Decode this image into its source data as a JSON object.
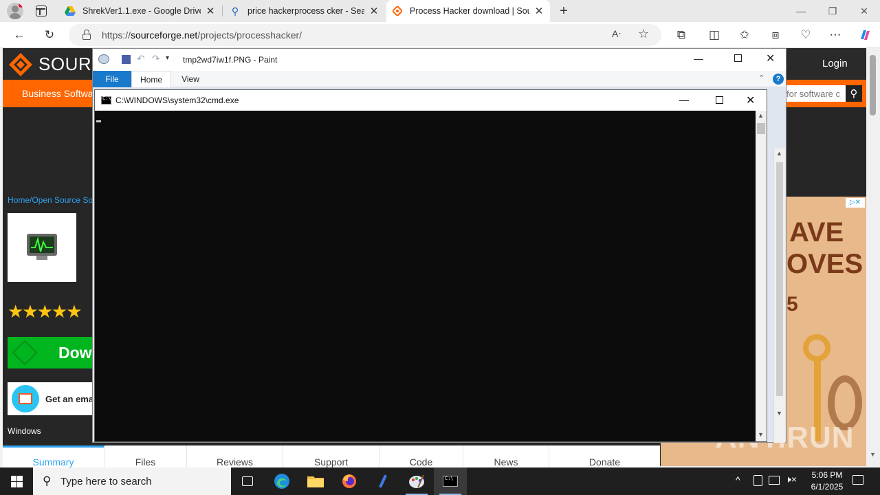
{
  "browser": {
    "tabs": [
      {
        "title": "ShrekVer1.1.exe - Google Drive",
        "icon": "google-drive-icon"
      },
      {
        "title": "price hackerprocess cker - Search",
        "icon": "search-icon"
      },
      {
        "title": "Process Hacker download | Sourc",
        "icon": "sourceforge-icon",
        "active": true
      }
    ],
    "url_prefix": "https://",
    "url_host": "sourceforge.net",
    "url_path": "/projects/processhacker/"
  },
  "site": {
    "logo_text": "SOURC",
    "login": "Login",
    "business_software": "Business Softwa",
    "search_placeholder": "for software c",
    "breadcrumb_home": "Home",
    "breadcrumb_sep": "/",
    "breadcrumb_oss": "Open Source So",
    "stars": "★★★★★",
    "download_label": "Dow",
    "email_label": "Get an ema",
    "platform": "Windows",
    "ad_text_1": "AVE",
    "ad_text_2": "OVES",
    "ad_text_3": "5",
    "nav": [
      "Summary",
      "Files",
      "Reviews",
      "Support",
      "Code",
      "News",
      "Donate"
    ]
  },
  "paint": {
    "title": "tmp2wd7iw1f.PNG - Paint",
    "tabs": [
      "File",
      "Home",
      "View"
    ]
  },
  "cmd": {
    "title": "C:\\WINDOWS\\system32\\cmd.exe"
  },
  "taskbar": {
    "search_placeholder": "Type here to search",
    "time": "5:06 PM",
    "date": "6/1/2025"
  },
  "watermark": "ANY.RUN",
  "colors": {
    "sourceforge_orange": "#ff6600",
    "download_green": "#00b51d",
    "paint_file_tab": "#1979ca",
    "taskbar": "#1f1f1f"
  }
}
